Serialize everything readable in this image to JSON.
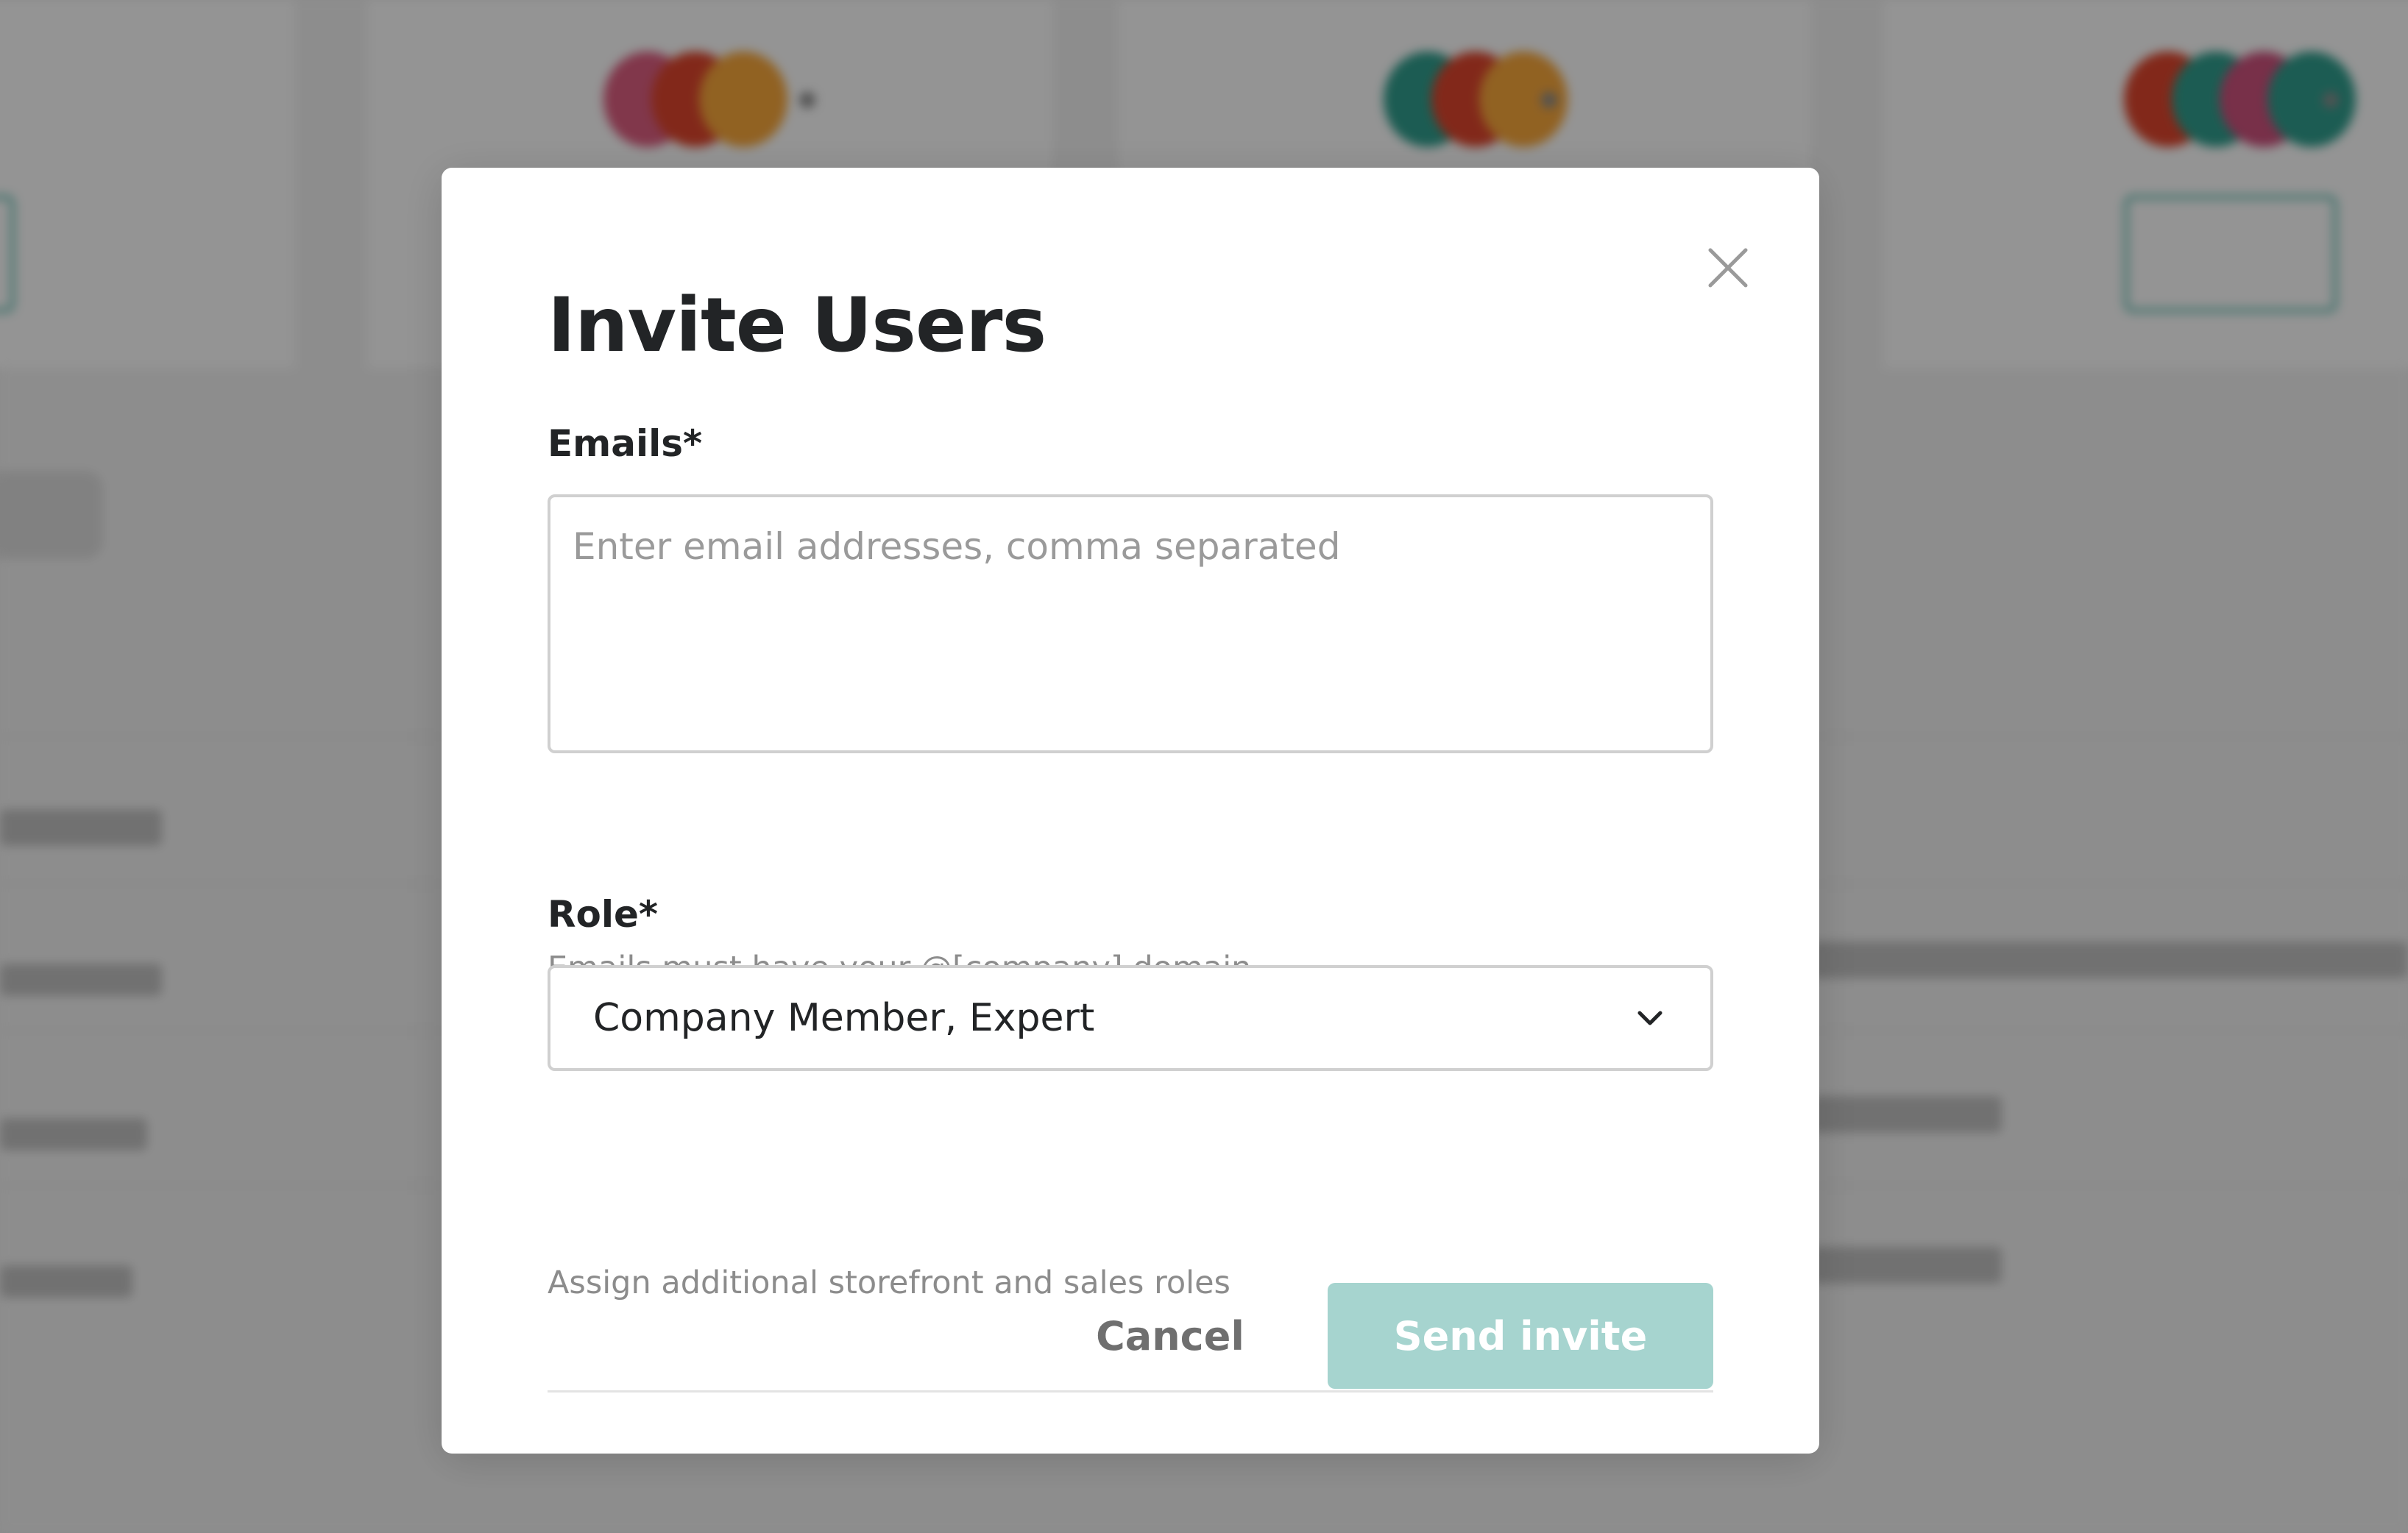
{
  "modal": {
    "title": "Invite Users",
    "close_icon": "close-icon",
    "emails": {
      "label": "Emails*",
      "placeholder": "Enter email addresses, comma separated",
      "value": "",
      "helper": "Emails must have your @[company] domain"
    },
    "role": {
      "label": "Role*",
      "selected": "Company Member, Expert",
      "chevron_icon": "chevron-down-icon",
      "helper": "Assign additional storefront and sales roles"
    },
    "actions": {
      "cancel_label": "Cancel",
      "send_label": "Send invite"
    }
  },
  "colors": {
    "accent": "#66bdb1",
    "send_button_disabled": "#a6d4cf",
    "overlay": "rgba(0,0,0,0.40)"
  }
}
